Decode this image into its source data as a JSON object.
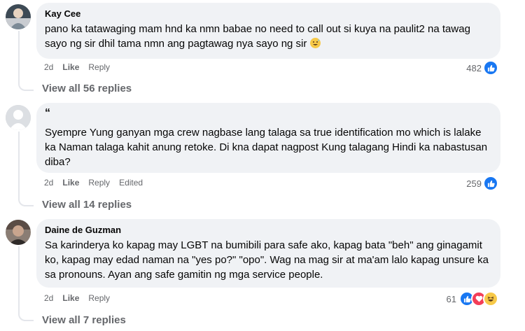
{
  "comments": [
    {
      "author": "Kay Cee",
      "text": "pano ka tatawaging mam hnd ka nmn babae no need to call out si kuya na paulit2 na tawag sayo ng sir dhil tama nmn ang pagtawag nya sayo ng sir",
      "emoji": "grinning-sweat-emoji",
      "time": "2d",
      "like": "Like",
      "reply": "Reply",
      "reaction_count": "482",
      "view_replies": "View all 56 replies"
    },
    {
      "author": "“",
      "text": "Syempre Yung ganyan mga crew nagbase lang talaga sa true identification mo which is lalake ka Naman talaga kahit anung retoke. Di kna dapat nagpost Kung talagang Hindi ka nabastusan diba?",
      "time": "2d",
      "like": "Like",
      "reply": "Reply",
      "edited": "Edited",
      "reaction_count": "259",
      "view_replies": "View all 14 replies"
    },
    {
      "author": "Daine de Guzman",
      "text": "Sa karinderya ko kapag may LGBT na bumibili para safe ako, kapag bata \"beh\" ang ginagamit ko, kapag may edad naman na \"yes po?\" \"opo\". Wag na mag sir at ma'am lalo kapag unsure ka sa pronouns. Ayan ang safe gamitin ng mga service people.",
      "time": "2d",
      "like": "Like",
      "reply": "Reply",
      "reaction_count": "61",
      "view_replies": "View all 7 replies"
    }
  ],
  "colors": {
    "like_blue": "#1877f2",
    "love_red": "#f33e58",
    "haha_yellow": "#f7c948",
    "bubble_bg": "#f0f2f5",
    "meta_gray": "#65676b"
  }
}
